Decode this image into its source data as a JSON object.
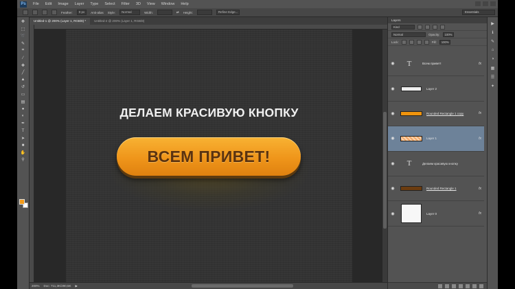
{
  "app": {
    "logo": "Ps"
  },
  "menu": [
    "File",
    "Edit",
    "Image",
    "Layer",
    "Type",
    "Select",
    "Filter",
    "3D",
    "View",
    "Window",
    "Help"
  ],
  "options": {
    "feather_label": "Feather:",
    "feather_value": "0 px",
    "antialias_label": "Anti-alias",
    "style_label": "Style:",
    "style_value": "Normal",
    "width_label": "Width:",
    "height_label": "Height:",
    "refine_label": "Refine Edge...",
    "workspace": "Essentials"
  },
  "tabs": [
    {
      "label": "Untitled-1 @ 200% (Layer 1, RGB/8) *",
      "active": true
    },
    {
      "label": "Untitled-2 @ 200% (Layer 1, RGB/8)",
      "active": false
    }
  ],
  "canvas": {
    "headline": "ДЕЛАЕМ КРАСИВУЮ КНОПКУ",
    "button_label": "ВСЕМ ПРИВЕТ!"
  },
  "status": {
    "zoom": "200%",
    "doc": "Doc: 711,3K/290,5K"
  },
  "layers_panel": {
    "title": "Layers",
    "filter": "Kind",
    "blend_mode": "Normal",
    "opacity_label": "Opacity:",
    "opacity_value": "100%",
    "lock_label": "Lock:",
    "fill_label": "Fill:",
    "fill_value": "100%",
    "layers": [
      {
        "name": "Всем привет!",
        "kind": "text",
        "fx": true,
        "active": false
      },
      {
        "name": "Layer 2",
        "kind": "pixel",
        "thumb_color": "#eeeeee",
        "fx": false,
        "active": false
      },
      {
        "name": "Rounded Rectangle 1 copy",
        "kind": "shape",
        "thumb_color": "#f0940d",
        "fx": true,
        "active": false
      },
      {
        "name": "Layer 1",
        "kind": "pixel",
        "thumb_color": "#f2a766",
        "fx": true,
        "active": true
      },
      {
        "name": "Делаем красивую кнопку",
        "kind": "text",
        "fx": false,
        "active": false
      },
      {
        "name": "Rounded Rectangle 1",
        "kind": "shape",
        "thumb_color": "#6b3c10",
        "fx": true,
        "active": false
      },
      {
        "name": "Layer 0",
        "kind": "pixel",
        "thumb_color": "#f7f7f7",
        "fx": true,
        "active": false
      }
    ]
  },
  "colors": {
    "accent_orange": "#f19a1a",
    "button_text": "#5a3310",
    "selected_layer": "#6d8299"
  }
}
